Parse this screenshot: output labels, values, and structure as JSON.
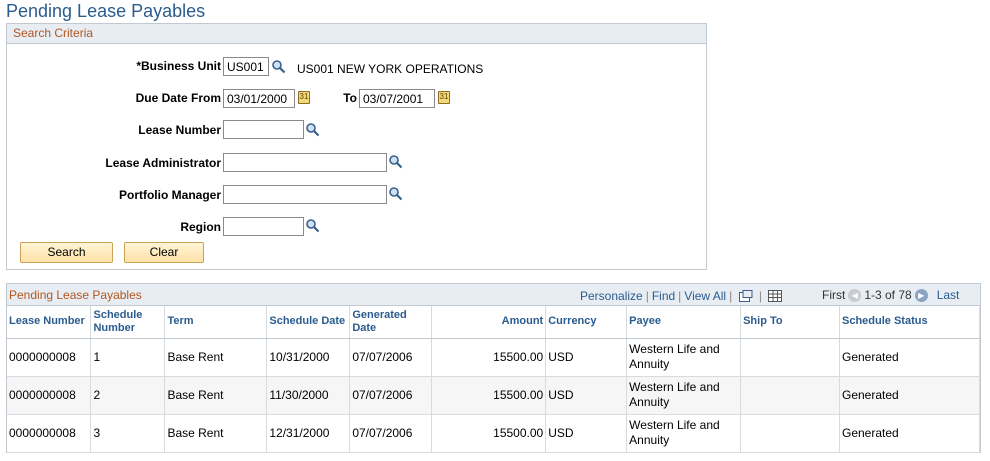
{
  "page_title": "Pending Lease Payables",
  "search": {
    "title": "Search Criteria",
    "business_unit": {
      "label": "*Business Unit",
      "value": "US001",
      "description": "US001 NEW YORK OPERATIONS"
    },
    "due_date_from": {
      "label": "Due Date From",
      "value": "03/01/2000"
    },
    "due_date_to": {
      "label": "To",
      "value": "03/07/2001"
    },
    "lease_number": {
      "label": "Lease Number",
      "value": ""
    },
    "lease_administrator": {
      "label": "Lease Administrator",
      "value": ""
    },
    "portfolio_manager": {
      "label": "Portfolio Manager",
      "value": ""
    },
    "region": {
      "label": "Region",
      "value": ""
    },
    "search_button": "Search",
    "clear_button": "Clear"
  },
  "grid": {
    "title": "Pending Lease Payables",
    "tools": {
      "personalize": "Personalize",
      "find": "Find",
      "view_all": "View All"
    },
    "nav": {
      "first": "First",
      "range": "1-3 of 78",
      "last": "Last"
    },
    "columns": [
      "Lease Number",
      "Schedule Number",
      "Term",
      "Schedule Date",
      "Generated Date",
      "Amount",
      "Currency",
      "Payee",
      "Ship To",
      "Schedule Status"
    ],
    "rows": [
      {
        "lease": "0000000008",
        "schedule": "1",
        "term": "Base Rent",
        "schedule_date": "10/31/2000",
        "generated_date": "07/07/2006",
        "amount": "15500.00",
        "currency": "USD",
        "payee": "Western Life and Annuity",
        "ship_to": "",
        "status": "Generated"
      },
      {
        "lease": "0000000008",
        "schedule": "2",
        "term": "Base Rent",
        "schedule_date": "11/30/2000",
        "generated_date": "07/07/2006",
        "amount": "15500.00",
        "currency": "USD",
        "payee": "Western Life and Annuity",
        "ship_to": "",
        "status": "Generated"
      },
      {
        "lease": "0000000008",
        "schedule": "3",
        "term": "Base Rent",
        "schedule_date": "12/31/2000",
        "generated_date": "07/07/2006",
        "amount": "15500.00",
        "currency": "USD",
        "payee": "Western Life and Annuity",
        "ship_to": "",
        "status": "Generated"
      }
    ]
  },
  "colors": {
    "title": "#2a5c8f",
    "section_header": "#b4561f",
    "header_bg": "#e7edf3",
    "button_bg": "#fde2a8"
  }
}
